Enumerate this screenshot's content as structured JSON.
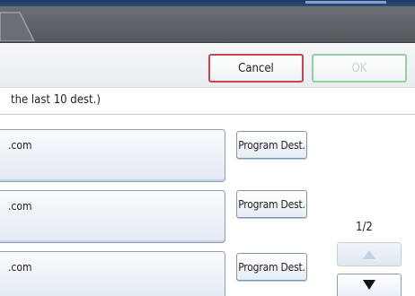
{
  "toolbar": {
    "cancel_label": "Cancel",
    "ok_label": "OK"
  },
  "instruction": "the last 10 dest.)",
  "destinations": [
    {
      "address": ".com",
      "program_label": "Program Dest."
    },
    {
      "address": ".com",
      "program_label": "Program Dest."
    },
    {
      "address": ".com",
      "program_label": "Program Dest."
    }
  ],
  "pager": {
    "page_indicator": "1/2",
    "up_icon": "triangle-up",
    "down_icon": "triangle-down"
  },
  "colors": {
    "header": "#55595e",
    "cancel_border": "#c8454e",
    "ok_border": "#93d29d",
    "field_border": "#8ea0b8"
  }
}
